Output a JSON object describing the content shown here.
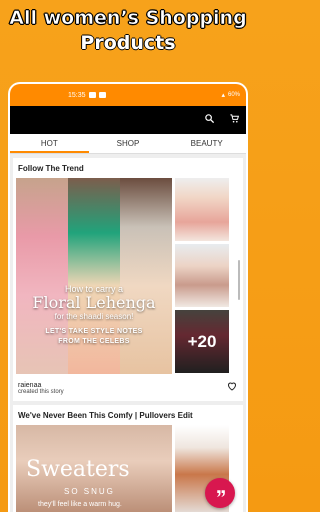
{
  "promo": {
    "line1": "All women’s Shopping",
    "line2": "Products"
  },
  "statusbar": {
    "time": "15:35",
    "battery": "60%"
  },
  "tabs": [
    {
      "label": "HOT",
      "active": true
    },
    {
      "label": "SHOP",
      "active": false
    },
    {
      "label": "BEAUTY",
      "active": false
    }
  ],
  "story1": {
    "title": "Follow The Trend",
    "overlay_line1": "How to carry a",
    "overlay_line2": "Floral Lehenga",
    "overlay_line3": "for the shaadi season!",
    "overlay_line4": "LET'S TAKE STYLE NOTES",
    "overlay_line5": "FROM THE CELEBS",
    "more_count": "+20",
    "author": "raienaa",
    "subtitle": "created this story"
  },
  "story2": {
    "title": "We've Never Been This Comfy | Pullovers Edit",
    "overlay_line1": "Sweaters",
    "overlay_line2": "SO SNUG",
    "overlay_line3": "they'll feel like a warm hug."
  },
  "colors": {
    "accent": "#ff8a00",
    "appbar": "#000000",
    "fab": "#d8174f",
    "background": "#f7a21b"
  },
  "icons": {
    "search": "search-icon",
    "cart": "cart-icon",
    "like": "heart-icon",
    "fab": "quote-icon"
  }
}
